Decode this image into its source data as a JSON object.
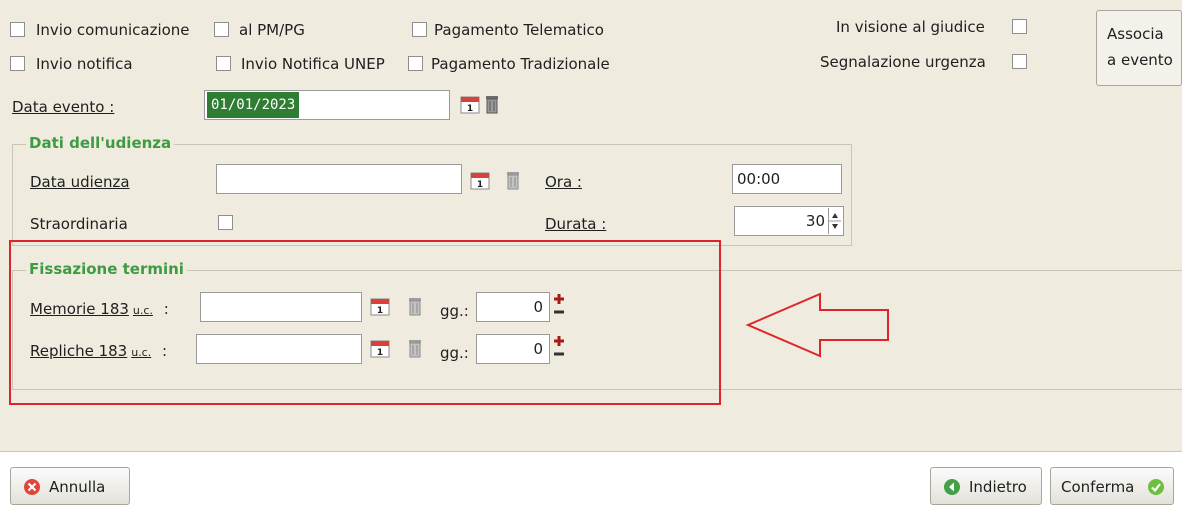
{
  "checkboxes": {
    "invio_comunicazione": "Invio comunicazione",
    "al_pm_pg": "al PM/PG",
    "pagamento_telematico": "Pagamento Telematico",
    "invio_notifica": "Invio notifica",
    "invio_notifica_unep": "Invio Notifica UNEP",
    "pagamento_tradizionale": "Pagamento Tradizionale",
    "in_visione_giudice": "In visione al giudice",
    "segnalazione_urgenza": "Segnalazione urgenza"
  },
  "associa_button": {
    "line1": "Associa",
    "line2": "a evento"
  },
  "data_evento": {
    "label": "Data evento :",
    "value": "01/01/2023"
  },
  "udienza": {
    "legend": "Dati dell'udienza",
    "data_label": "Data udienza",
    "data_value": "",
    "ora_label": "Ora :",
    "ora_value": "00:00",
    "straordinaria_label": "Straordinaria",
    "durata_label": "Durata :",
    "durata_value": "30"
  },
  "termini": {
    "legend": "Fissazione termini",
    "memorie_label": "Memorie 183",
    "memorie_suffix": "u.c.",
    "memorie_colon": ":",
    "memorie_gg_label": "gg.:",
    "memorie_gg_value": "0",
    "repliche_label": "Repliche 183",
    "repliche_suffix": "u.c.",
    "repliche_colon": ":",
    "repliche_gg_label": "gg.:",
    "repliche_gg_value": "0"
  },
  "footer": {
    "annulla": "Annulla",
    "indietro": "Indietro",
    "conferma": "Conferma"
  },
  "colors": {
    "form_bg": "#efebde",
    "legend_green": "#3f9b43",
    "annotation_red": "#e0242b",
    "selection_green": "#2e7d32"
  },
  "icons": [
    "calendar-icon",
    "trash-icon",
    "plus-minus-icon",
    "cancel-icon",
    "back-icon",
    "confirm-icon",
    "arrow-annotation"
  ]
}
